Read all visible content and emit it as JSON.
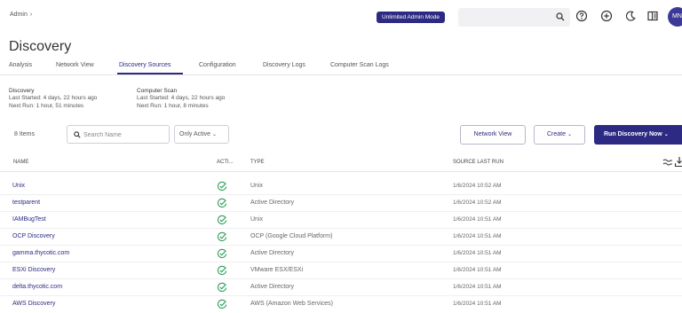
{
  "breadcrumb": {
    "label": "Admin"
  },
  "header": {
    "admin_mode_badge": "Unlimited Admin Mode",
    "avatar_initials": "MN"
  },
  "page": {
    "title": "Discovery"
  },
  "tabs": [
    {
      "label": "Analysis",
      "active": false
    },
    {
      "label": "Network View",
      "active": false
    },
    {
      "label": "Discovery Sources",
      "active": true
    },
    {
      "label": "Configuration",
      "active": false
    },
    {
      "label": "Discovery Logs",
      "active": false
    },
    {
      "label": "Computer Scan Logs",
      "active": false
    }
  ],
  "discovery_info": {
    "title": "Discovery",
    "last_started": "Last Started: 4 days, 22 hours ago",
    "next_run": "Next Run: 1 hour, 51 minutes"
  },
  "computer_scan_info": {
    "title": "Computer Scan",
    "last_started": "Last Started: 4 days, 22 hours ago",
    "next_run": "Next Run: 1 hour, 8 minutes"
  },
  "toolbar": {
    "item_count": "8 Items",
    "search_placeholder": "Search Name",
    "filter_label": "Only Active",
    "network_view_button": "Network View",
    "create_button": "Create",
    "run_discovery_button": "Run Discovery Now"
  },
  "table": {
    "columns": {
      "name": "NAME",
      "active": "ACTI...",
      "type": "TYPE",
      "last_run": "SOURCE LAST RUN"
    },
    "rows": [
      {
        "name": "Unix",
        "type": "Unix",
        "last_run": "1/6/2024 10:52 AM"
      },
      {
        "name": "testparent",
        "type": "Active Directory",
        "last_run": "1/6/2024 10:52 AM"
      },
      {
        "name": "IAMBugTest",
        "type": "Unix",
        "last_run": "1/6/2024 10:51 AM"
      },
      {
        "name": "OCP Discovery",
        "type": "OCP (Google Cloud Platform)",
        "last_run": "1/6/2024 10:51 AM"
      },
      {
        "name": "gamma.thycotic.com",
        "type": "Active Directory",
        "last_run": "1/6/2024 10:51 AM"
      },
      {
        "name": "ESXi Discovery",
        "type": "VMware ESX/ESXi",
        "last_run": "1/6/2024 10:51 AM"
      },
      {
        "name": "delta.thycotic.com",
        "type": "Active Directory",
        "last_run": "1/6/2024 10:51 AM"
      },
      {
        "name": "AWS Discovery",
        "type": "AWS (Amazon Web Services)",
        "last_run": "1/6/2024 10:51 AM"
      }
    ]
  },
  "colors": {
    "accent": "#2c2a82",
    "active_check": "#2e9e5a"
  },
  "icons": [
    "search-icon",
    "help-icon",
    "add-icon",
    "dark-mode-icon",
    "panel-toggle-icon",
    "check-circle-icon",
    "column-settings-icon",
    "export-icon"
  ]
}
